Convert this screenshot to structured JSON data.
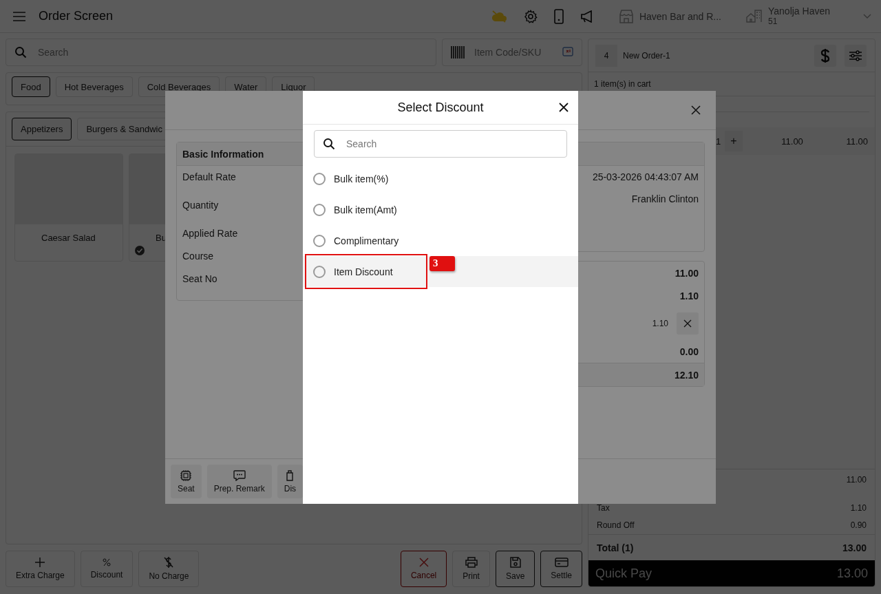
{
  "header": {
    "title": "Order Screen",
    "store": "Haven Bar and R...",
    "user": "Yanolja Haven",
    "user_sub": "51"
  },
  "search": {
    "placeholder": "Search"
  },
  "sku": {
    "placeholder": "Item Code/SKU"
  },
  "categories": [
    {
      "label": "Food",
      "selected": true
    },
    {
      "label": "Hot Beverages",
      "selected": false
    },
    {
      "label": "Cold Beverages",
      "selected": false
    },
    {
      "label": "Water",
      "selected": false
    },
    {
      "label": "Liquor",
      "selected": false
    }
  ],
  "subcategories": [
    {
      "label": "Appetizers",
      "selected": true
    },
    {
      "label": "Burgers & Sandwic",
      "selected": false
    }
  ],
  "items": [
    {
      "name": "Caesar Salad",
      "checked": false
    },
    {
      "name": "Bu",
      "checked": true
    }
  ],
  "actions": [
    {
      "kind": "extra",
      "label": "Extra Charge"
    },
    {
      "kind": "discount",
      "label": "Discount"
    },
    {
      "kind": "nocharge",
      "label": "No Charge"
    }
  ],
  "order_actions": [
    {
      "kind": "cancel",
      "label": "Cancel"
    },
    {
      "kind": "print",
      "label": "Print"
    },
    {
      "kind": "save",
      "label": "Save"
    },
    {
      "kind": "settle",
      "label": "Settle"
    }
  ],
  "order": {
    "number": "4",
    "name": "New Order-1",
    "cart_count": "1 item(s) in cart",
    "rows": [
      {
        "qty": "1",
        "plus": "+",
        "rate": "11.00",
        "amount": "11.00"
      }
    ],
    "summary": [
      {
        "value": "11.00"
      },
      {
        "label": "Tax",
        "value": "1.10"
      },
      {
        "label": "Round Off",
        "value": "0.90"
      }
    ],
    "total": {
      "label": "Total (1)",
      "value": "13.00"
    },
    "quick_pay": {
      "label": "Quick Pay",
      "value": "13.00"
    }
  },
  "item_dialog": {
    "section": "Basic Information",
    "fields": [
      "Default Rate",
      "Quantity",
      "Applied Rate",
      "Course",
      "Seat No"
    ],
    "info_values": [
      "25-03-2026 04:43:07 AM",
      "Franklin Clinton"
    ],
    "amounts": [
      {
        "kind": "amount",
        "value": "11.00"
      },
      {
        "kind": "amount",
        "value": "1.10"
      },
      {
        "kind": "removable",
        "value": "1.10"
      },
      {
        "kind": "amount",
        "value": "0.00"
      },
      {
        "kind": "total",
        "value": "12.10"
      }
    ],
    "footer_buttons": [
      {
        "kind": "seat",
        "label": "Seat"
      },
      {
        "kind": "remark",
        "label": "Prep. Remark"
      },
      {
        "kind": "discount",
        "label": "Dis"
      }
    ]
  },
  "discount_dialog": {
    "title": "Select Discount",
    "search_placeholder": "Search",
    "options": [
      {
        "label": "Bulk item(%)",
        "selected": false,
        "highlighted": false
      },
      {
        "label": "Bulk item(Amt)",
        "selected": false,
        "highlighted": false
      },
      {
        "label": "Complimentary",
        "selected": false,
        "highlighted": false
      },
      {
        "label": "Item Discount",
        "selected": false,
        "highlighted": true,
        "callout": "3"
      }
    ]
  }
}
